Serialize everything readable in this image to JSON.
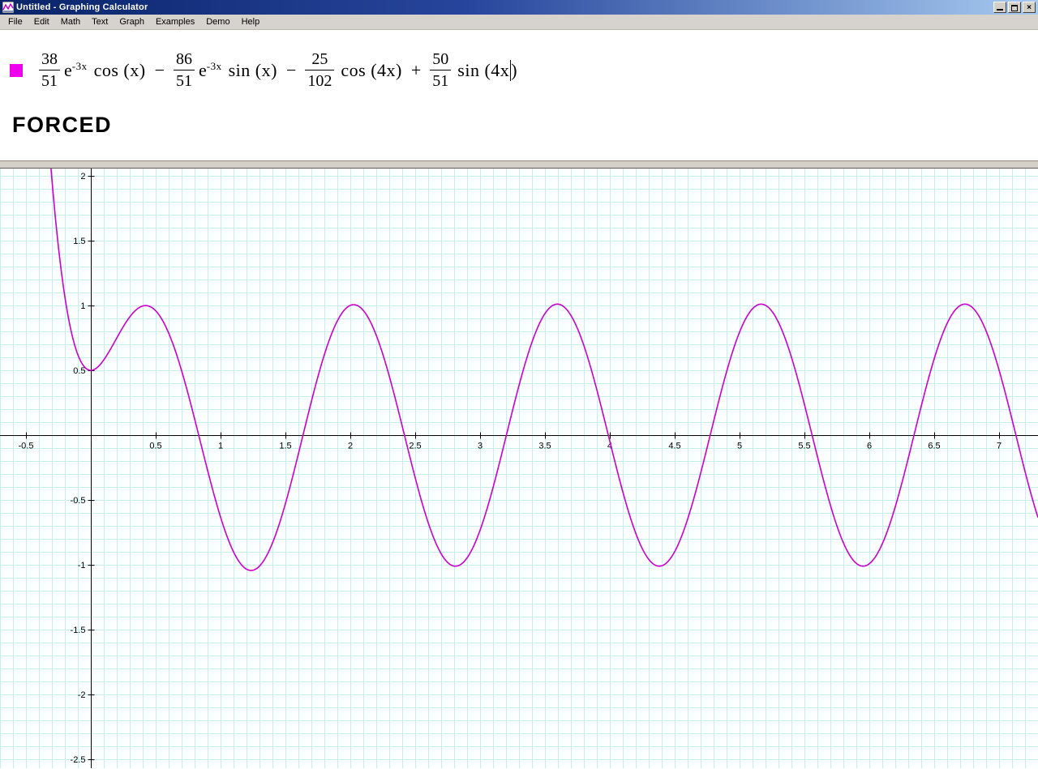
{
  "window": {
    "title": "Untitled - Graphing Calculator"
  },
  "icons": {
    "app": "graph-window-icon",
    "minimize": "css-bar",
    "maximize": "css-square",
    "close": "×"
  },
  "menu": {
    "items": [
      "File",
      "Edit",
      "Math",
      "Text",
      "Graph",
      "Examples",
      "Demo",
      "Help"
    ]
  },
  "equation": {
    "swatch_color": "#ee00ee",
    "t1": {
      "num": "38",
      "den": "51",
      "base": "e",
      "sup": "-3x",
      "fn": "cos (x)"
    },
    "op1": "−",
    "t2": {
      "num": "86",
      "den": "51",
      "base": "e",
      "sup": "-3x",
      "fn": "sin (x)"
    },
    "op2": "−",
    "t3": {
      "num": "25",
      "den": "102",
      "fn": "cos (4x)"
    },
    "op3": "+",
    "t4": {
      "num": "50",
      "den": "51",
      "fn_open": "sin (4x",
      "fn_close": ")"
    }
  },
  "label": {
    "text": "FORCED"
  },
  "chart_data": {
    "type": "line",
    "title": "",
    "xlabel": "",
    "ylabel": "",
    "x_axis": {
      "min": -0.7,
      "max": 7.3,
      "tick_step": 0.5,
      "grid_step": 0.1,
      "tick_labels": [
        "-0.5",
        "0.5",
        "1",
        "1.5",
        "2",
        "2.5",
        "3",
        "3.5",
        "4",
        "4.5",
        "5",
        "5.5",
        "6",
        "6.5",
        "7"
      ]
    },
    "y_axis": {
      "min": -2.56875,
      "max": 2.05625,
      "tick_step": 0.5,
      "grid_step": 0.1,
      "tick_labels": [
        "2",
        "1.5",
        "1",
        "0.5",
        "-0.5",
        "-1",
        "-1.5",
        "-2",
        "-2.5"
      ]
    },
    "grid": true,
    "grid_color": "#c7eded",
    "axis_color": "#000000",
    "background": "#fcffff",
    "legend": "none",
    "series": [
      {
        "name": "forced-oscillation-curve",
        "color": "#cc00cc",
        "expression": "(38/51)e^(-3x)cos(x) - (86/51)e^(-3x)sin(x) - (25/102)cos(4x) + (50/51)sin(4x)",
        "terms": [
          {
            "sign": 1,
            "coef": [
              38,
              51
            ],
            "exp_rate": -3,
            "trig": "cos",
            "freq": 1
          },
          {
            "sign": -1,
            "coef": [
              86,
              51
            ],
            "exp_rate": -3,
            "trig": "sin",
            "freq": 1
          },
          {
            "sign": -1,
            "coef": [
              25,
              102
            ],
            "exp_rate": 0,
            "trig": "cos",
            "freq": 4
          },
          {
            "sign": 1,
            "coef": [
              50,
              51
            ],
            "exp_rate": 0,
            "trig": "sin",
            "freq": 4
          }
        ],
        "key_points": {
          "y_at_0": 0.5,
          "steady_state_amplitude": 1.01,
          "period": 1.5708,
          "peaks_x": [
            0.45,
            2.03,
            3.6,
            5.17,
            6.74
          ],
          "troughs_x": [
            1.24,
            2.81,
            4.38,
            5.95
          ]
        }
      }
    ]
  }
}
